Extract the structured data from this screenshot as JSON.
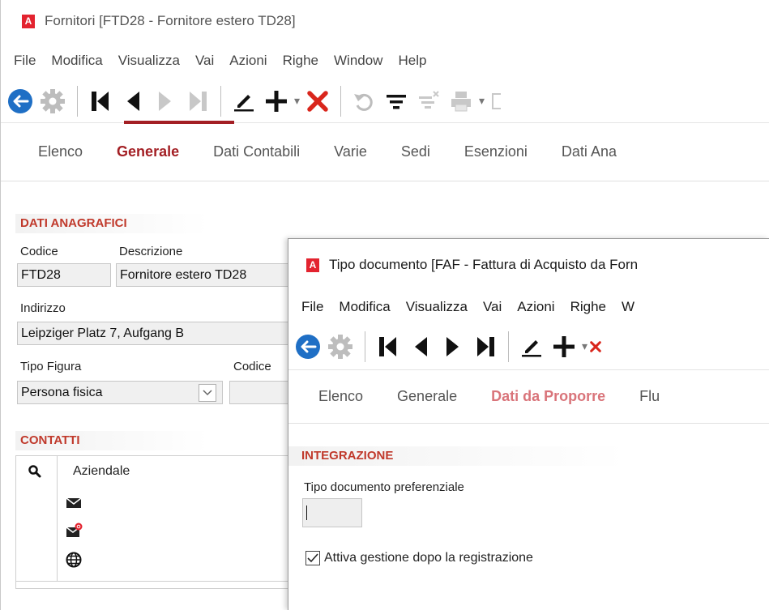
{
  "main_window": {
    "title": "Fornitori [FTD28 - Fornitore estero TD28]",
    "app_icon_letter": "A",
    "menu": [
      "File",
      "Modifica",
      "Visualizza",
      "Vai",
      "Azioni",
      "Righe",
      "Window",
      "Help"
    ],
    "tabs": [
      {
        "label": "Elenco"
      },
      {
        "label": "Generale",
        "active": true
      },
      {
        "label": "Dati Contabili"
      },
      {
        "label": "Varie"
      },
      {
        "label": "Sedi"
      },
      {
        "label": "Esenzioni"
      },
      {
        "label": "Dati Ana"
      }
    ],
    "section_anagrafici": "DATI ANAGRAFICI",
    "fields": {
      "codice_label": "Codice",
      "codice_value": "FTD28",
      "descrizione_label": "Descrizione",
      "descrizione_value": "Fornitore estero TD28",
      "indirizzo_label": "Indirizzo",
      "indirizzo_value": "Leipziger Platz 7, Aufgang B",
      "tipo_figura_label": "Tipo Figura",
      "tipo_figura_value": "Persona fisica",
      "codice2_label": "Codice"
    },
    "section_contatti": "CONTATTI",
    "contacts": {
      "header": "Aziendale",
      "icons": [
        "email-icon",
        "email-at-icon",
        "globe-icon"
      ]
    }
  },
  "dialog_window": {
    "title": "Tipo documento [FAF - Fattura di Acquisto da Forn",
    "app_icon_letter": "A",
    "menu": [
      "File",
      "Modifica",
      "Visualizza",
      "Vai",
      "Azioni",
      "Righe",
      "W"
    ],
    "tabs": [
      {
        "label": "Elenco"
      },
      {
        "label": "Generale"
      },
      {
        "label": "Dati da Proporre",
        "active": true
      },
      {
        "label": "Flu"
      }
    ],
    "section_integrazione": "INTEGRAZIONE",
    "tipo_documento_label": "Tipo documento preferenziale",
    "tipo_documento_value": "",
    "attiva_gestione_label": "Attiva gestione dopo la registrazione",
    "attiva_gestione_checked": true
  },
  "colors": {
    "accent_red": "#a31f24",
    "delete_red": "#d9261c",
    "back_blue": "#1f6fc5",
    "section_red": "#c0392b"
  }
}
